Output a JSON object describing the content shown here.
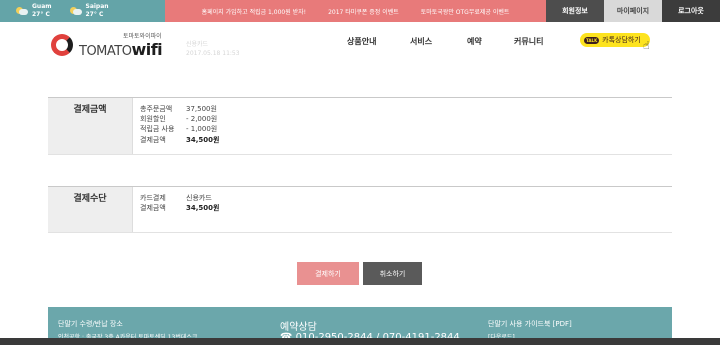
{
  "topbar": {
    "weather": [
      {
        "city": "Guam",
        "temp": "27° C"
      },
      {
        "city": "Saipan",
        "temp": "27° C"
      }
    ],
    "events": [
      "홈페이지 가입하고 적립금 1,000원 받자!",
      "2017 타미쿠폰 증정 이벤트",
      "토마토국왕만 OTG무료제공 이벤트"
    ],
    "account": {
      "member_info": "회원정보",
      "mypage": "마이페이지",
      "logout": "로그아웃"
    }
  },
  "header": {
    "logo_sub": "토마토와이파이",
    "logo_main": "TOMATO",
    "logo_wifi": "wifi",
    "nav": [
      "상품안내",
      "서비스",
      "예약",
      "커뮤니티"
    ],
    "kakao_badge": "TALK",
    "kakao_label": "카톡상담하기"
  },
  "ghost_text": [
    "신용카드",
    "2017.05.18 11:53"
  ],
  "payment_amount": {
    "label": "결제금액",
    "rows": [
      {
        "name": "총주문금액",
        "value": "37,500원"
      },
      {
        "name": "회원할인",
        "value": "- 2,000원"
      },
      {
        "name": "적립금 사용",
        "value": "- 1,000원"
      },
      {
        "name": "결제금액",
        "value": "34,500원"
      }
    ]
  },
  "payment_method": {
    "label": "결제수단",
    "rows": [
      {
        "name": "카드결제",
        "value": "신용카드"
      },
      {
        "name": "결제금액",
        "value": "34,500원"
      }
    ]
  },
  "buttons": {
    "pay": "결제하기",
    "cancel": "취소하기"
  },
  "footer": {
    "left_title": "단말기 수령/반납 장소",
    "left_line": "인천공항 : 출국장 3층 A카운터 토마토센딩 13번데스크",
    "center_title": "예약상담",
    "center_phone": "☎ 010-2950-2844 / 070-4191-2844",
    "right_title": "단말기 사용 가이드북 [PDF]",
    "right_link": "[다운로드]"
  },
  "colors": {
    "teal": "#6ba7ab",
    "coral": "#e87a7a",
    "kakao": "#fde31f"
  }
}
